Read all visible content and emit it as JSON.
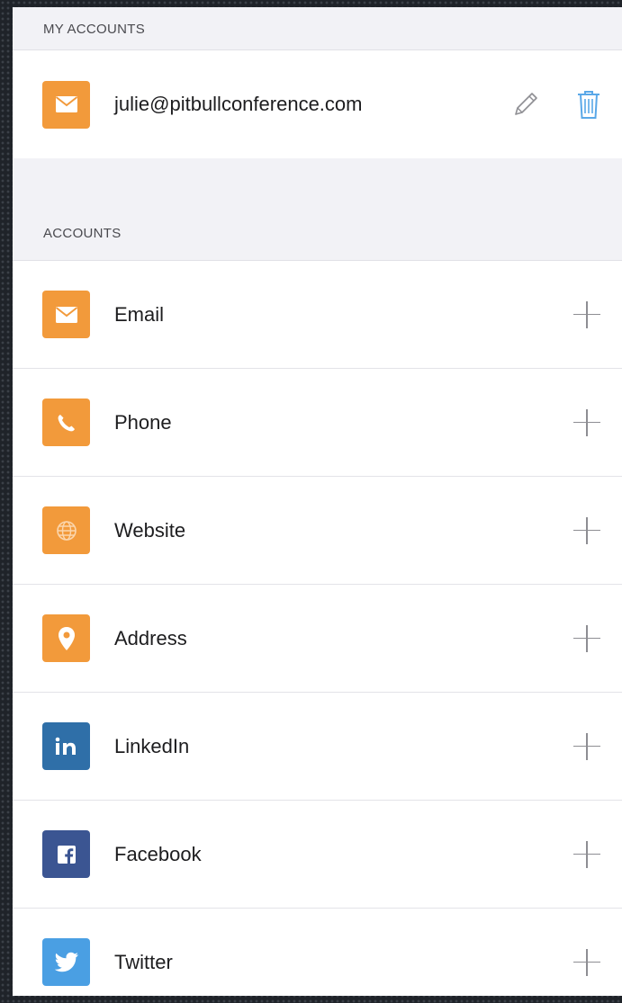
{
  "my_accounts": {
    "header": "MY ACCOUNTS",
    "email": "julie@pitbullconference.com"
  },
  "accounts": {
    "header": "ACCOUNTS",
    "items": [
      {
        "label": "Email",
        "icon": "envelope-icon",
        "color": "#f29a3b"
      },
      {
        "label": "Phone",
        "icon": "phone-icon",
        "color": "#f29a3b"
      },
      {
        "label": "Website",
        "icon": "globe-icon",
        "color": "#f29a3b"
      },
      {
        "label": "Address",
        "icon": "map-pin-icon",
        "color": "#f29a3b"
      },
      {
        "label": "LinkedIn",
        "icon": "linkedin-icon",
        "color": "#2f6fa8"
      },
      {
        "label": "Facebook",
        "icon": "facebook-icon",
        "color": "#3b5592"
      },
      {
        "label": "Twitter",
        "icon": "twitter-icon",
        "color": "#4a9fe3"
      }
    ]
  },
  "colors": {
    "accent": "#f29a3b",
    "trash": "#5aa8e8",
    "edit": "#8e8e93"
  }
}
